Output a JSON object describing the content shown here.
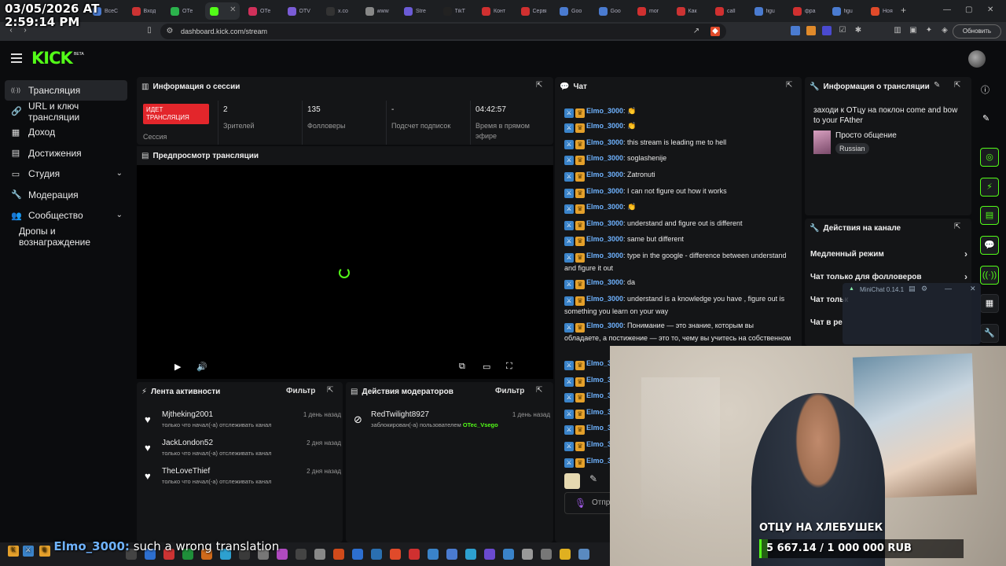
{
  "overlay_clock": {
    "date": "03/05/2026 AT",
    "time": "2:59:14 PM"
  },
  "browser": {
    "tabs": [
      {
        "label": "ВсеС",
        "color": "#4a7bd0"
      },
      {
        "label": "Вход",
        "color": "#c33"
      },
      {
        "label": "ОТе",
        "color": "#2bb24c"
      },
      {
        "label": "",
        "color": "#53fc18",
        "active": true
      },
      {
        "label": "ОТе",
        "color": "#d0305a"
      },
      {
        "label": "ОТV",
        "color": "#7a5cd6"
      },
      {
        "label": "x.co",
        "color": "#333"
      },
      {
        "label": "www",
        "color": "#888"
      },
      {
        "label": "Stre",
        "color": "#6b5bd6"
      },
      {
        "label": "TikT",
        "color": "#222"
      },
      {
        "label": "Конт",
        "color": "#d03030"
      },
      {
        "label": "Сервi",
        "color": "#d03030"
      },
      {
        "label": "Goo",
        "color": "#4a7bd0"
      },
      {
        "label": "Goo",
        "color": "#4a7bd0"
      },
      {
        "label": "mor",
        "color": "#d03030"
      },
      {
        "label": "Как",
        "color": "#c33"
      },
      {
        "label": "call",
        "color": "#d03030"
      },
      {
        "label": "figu",
        "color": "#4a7bd0"
      },
      {
        "label": "фра",
        "color": "#d03030"
      },
      {
        "label": "figu",
        "color": "#4a7bd0"
      },
      {
        "label": "Ноя",
        "color": "#e04a2a"
      }
    ],
    "url": "dashboard.kick.com/stream",
    "update_button": "Обновить"
  },
  "app": {
    "logo": "KICK",
    "beta": "BETA"
  },
  "sidebar": {
    "items": [
      {
        "icon": "broadcast-icon",
        "glyph": "((·))",
        "label": "Трансляция",
        "active": true
      },
      {
        "icon": "link-icon",
        "glyph": "🔗",
        "label": "URL и ключ трансляции"
      },
      {
        "icon": "income-icon",
        "glyph": "▦",
        "label": "Доход"
      },
      {
        "icon": "achievements-icon",
        "glyph": "▤",
        "label": "Достижения"
      },
      {
        "icon": "studio-icon",
        "glyph": "▭",
        "label": "Студия",
        "chevron": true
      },
      {
        "icon": "moderation-icon",
        "glyph": "🔧",
        "label": "Модерация"
      },
      {
        "icon": "community-icon",
        "glyph": "👥",
        "label": "Сообщество",
        "chevron": true
      },
      {
        "icon": "",
        "glyph": "",
        "label": "Дропы и вознаграждение"
      }
    ]
  },
  "session": {
    "title": "Информация о сессии",
    "live_badge": "ИДЕТ ТРАНСЛЯЦИЯ",
    "session_label": "Сессия",
    "stats": [
      {
        "value": "2",
        "label": "Зрителей"
      },
      {
        "value": "135",
        "label": "Фолловеры"
      },
      {
        "value": "-",
        "label": "Подсчет подписок"
      },
      {
        "value": "04:42:57",
        "label": "Время в прямом эфире"
      }
    ]
  },
  "preview": {
    "title": "Предпросмотр трансляции"
  },
  "activity": {
    "title": "Лента активности",
    "filter": "Фильтр",
    "items": [
      {
        "name": "Mjtheking2001",
        "time": "1 день назад",
        "desc": "только что начал(-а) отслеживать канал"
      },
      {
        "name": "JackLondon52",
        "time": "2 дня назад",
        "desc": "только что начал(-а) отслеживать канал"
      },
      {
        "name": "TheLoveThief",
        "time": "2 дня назад",
        "desc": "только что начал(-а) отслеживать канал"
      }
    ]
  },
  "mod_actions": {
    "title": "Действия модераторов",
    "filter": "Фильтр",
    "items": [
      {
        "name": "RedTwilight8927",
        "time": "1 день назад",
        "desc": "заблокирован(-а) пользователем",
        "by": "OTec_Vsego"
      }
    ]
  },
  "chat": {
    "title": "Чат",
    "username": "Elmo_3000",
    "messages": [
      {
        "text": "",
        "emote": "👏"
      },
      {
        "text": "",
        "emote": "👏"
      },
      {
        "text": "this stream is leading me to hell"
      },
      {
        "text": "soglashenije"
      },
      {
        "text": "Zatronuti"
      },
      {
        "text": "I can not figure out how it works"
      },
      {
        "text": "",
        "emote": "👏"
      },
      {
        "text": "understand and figure out is different"
      },
      {
        "text": "same but different"
      },
      {
        "text": "type in the google - difference between understand and figure it out"
      },
      {
        "text": "da"
      },
      {
        "text": "understand is a knowledge you have , figure out is something you learn on your way"
      },
      {
        "text": "Понимание — это знание, которым вы обладаете, а постижение — это то, чему вы учитесь на собственном"
      }
    ],
    "truncated_name": "Elmo_3",
    "send_placeholder": "Отпр"
  },
  "stream_info": {
    "title": "Информация о трансляции",
    "stream_title": "заходи к ОТцу на поклон come and bow to your FAther",
    "category": "Просто общение",
    "language": "Russian"
  },
  "channel_actions": {
    "title": "Действия на канале",
    "items": [
      "Медленный режим",
      "Чат только для фолловеров",
      "Чат тольк",
      "Чат в ре"
    ]
  },
  "minichat": {
    "title": "MiniChat 0.14.1"
  },
  "webcam": {
    "title": "ОТЦУ НА ХЛЕБУШЕК",
    "goal_text": "5 667.14 / 1 000 000 RUB",
    "goal_fraction": 0.00567
  },
  "overlay_message": {
    "user": "Elmo_3000:",
    "text": "such a wrong translation"
  }
}
